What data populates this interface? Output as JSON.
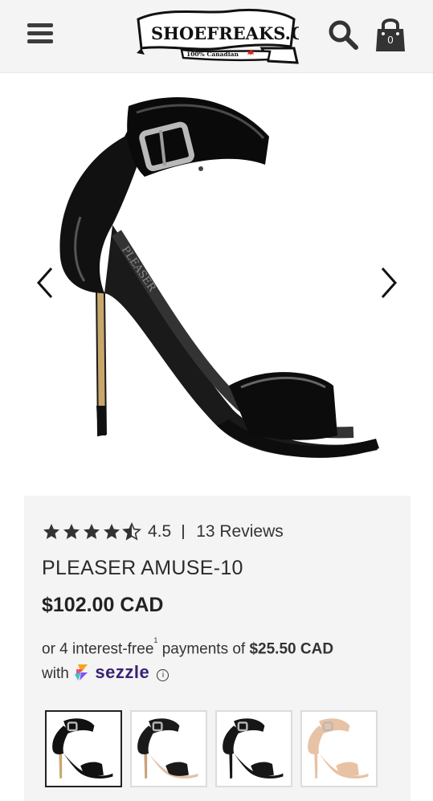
{
  "header": {
    "logo_text": "SHOEFREAKS.CA",
    "logo_tagline": "100% Canadian",
    "cart_count": "0"
  },
  "product": {
    "rating": "4.5",
    "reviews_label": "13 Reviews",
    "title": "PLEASER AMUSE-10",
    "price": "$102.00 CAD",
    "image_brand_text": "PLEASER"
  },
  "payments": {
    "prefix": "or 4 interest-free",
    "footnote": "1",
    "middle": " payments of ",
    "amount": "$25.50 CAD",
    "with": "with",
    "provider": "sezzle",
    "info_symbol": "i"
  },
  "thumbnails": [
    {
      "name": "black-patent",
      "strap": "#111111",
      "heel": "#c8a76b",
      "sole": "#111111",
      "selected": true
    },
    {
      "name": "black-nude",
      "strap": "#1a1a1a",
      "heel": "#c9a27c",
      "sole": "#e3c3a8",
      "selected": false
    },
    {
      "name": "black-suede",
      "strap": "#161616",
      "heel": "#161616",
      "sole": "#161616",
      "selected": false
    },
    {
      "name": "nude-patent",
      "strap": "#e8c2a4",
      "heel": "#e8c2a4",
      "sole": "#e8c2a4",
      "selected": false
    }
  ],
  "colors": {
    "header_bg": "#f4f4f4",
    "panel_bg": "#f4f4f4",
    "star": "#333333",
    "sezzle_purple": "#3a2275"
  }
}
